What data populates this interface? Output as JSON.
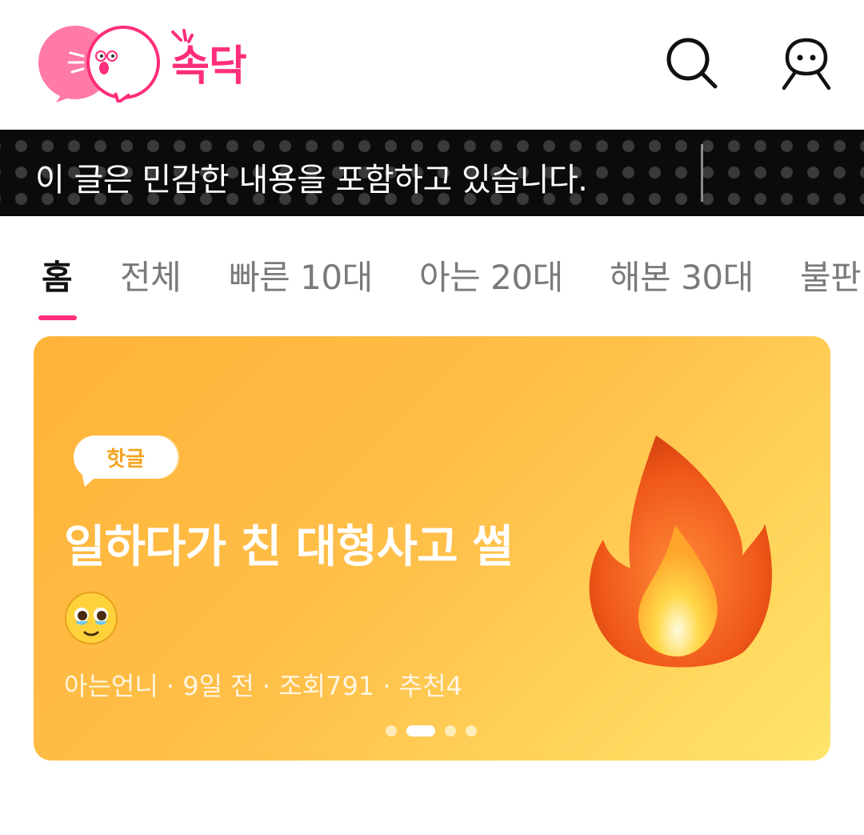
{
  "header": {
    "logo_text": "속닥",
    "search_icon": "search-icon",
    "profile_icon": "profile-icon",
    "brand_color": "#ff2d7a"
  },
  "ticker": {
    "text": "이 글은 민감한 내용을 포함하고 있습니다."
  },
  "tabs": [
    {
      "label": "홈",
      "active": true
    },
    {
      "label": "전체",
      "active": false
    },
    {
      "label": "빠른 10대",
      "active": false
    },
    {
      "label": "아는 20대",
      "active": false
    },
    {
      "label": "해본 30대",
      "active": false
    },
    {
      "label": "불판",
      "active": false
    }
  ],
  "hero": {
    "badge": "핫글",
    "title": "일하다가 친 대형사고 썰",
    "emoji_icon": "pleading-face-icon",
    "meta": "아는언니 · 9일 전 · 조회791 · 추천4",
    "illustration_icon": "fire-icon",
    "page_count": 4,
    "active_page": 2
  }
}
